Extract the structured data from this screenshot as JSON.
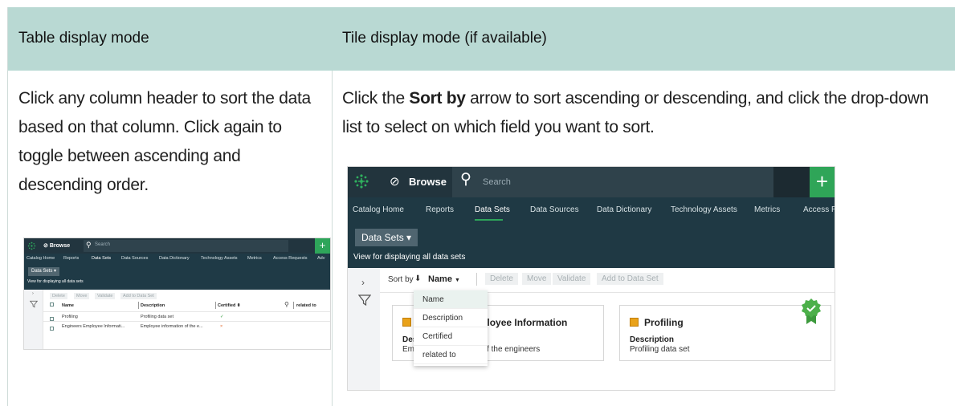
{
  "table": {
    "left_header": "Table display mode",
    "right_header": "Tile display mode (if available)",
    "left_text": "Click any column header to sort the data based on that column. Click again to toggle between ascending and descending order.",
    "right_text_pre": "Click the ",
    "right_text_bold": "Sort by",
    "right_text_post": " arrow to sort ascending or descending, and click the drop-down list to select on which field you want to sort."
  },
  "shot_small": {
    "browse": "Browse",
    "search_placeholder": "Search",
    "plus": "+",
    "nav": [
      "Catalog Home",
      "Reports",
      "Data Sets",
      "Data Sources",
      "Data Dictionary",
      "Technology Assets",
      "Metrics",
      "Access Requests",
      "Adv"
    ],
    "ds_button": "Data Sets ▾",
    "view_text": "View for displaying all data sets",
    "toolbar": [
      "Delete",
      "Move",
      "Validate",
      "Add to Data Set"
    ],
    "columns": [
      "Name",
      "Description",
      "Certified ⬍",
      "related to"
    ],
    "rows": [
      {
        "name": "Profiling",
        "description": "Profiling data set",
        "certified": "✓"
      },
      {
        "name": "Engineers Employee Informati...",
        "description": "Employee information of the e...",
        "certified": "×"
      }
    ]
  },
  "shot_large": {
    "browse": "Browse",
    "search_placeholder": "Search",
    "plus": "+",
    "nav": [
      "Catalog Home",
      "Reports",
      "Data Sets",
      "Data Sources",
      "Data Dictionary",
      "Technology Assets",
      "Metrics",
      "Access R"
    ],
    "ds_button": "Data Sets ▾",
    "view_text": "View for displaying all data sets",
    "sort_by": "Sort by",
    "sort_arrow": "⬇",
    "sort_field": "Name",
    "toolbar": [
      "Delete",
      "Move",
      "Validate",
      "Add to Data Set"
    ],
    "dropdown": [
      "Name",
      "Description",
      "Certified",
      "related to"
    ],
    "cards": [
      {
        "title": "Engineers Employee Information",
        "description_label": "Description",
        "description": "Employee information of the engineers"
      },
      {
        "title": "Profiling",
        "description_label": "Description",
        "description": "Profiling data set"
      }
    ]
  }
}
